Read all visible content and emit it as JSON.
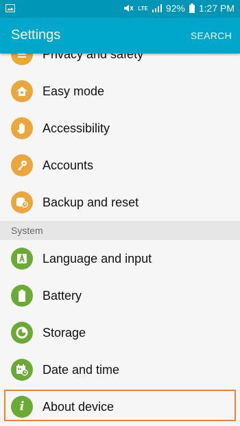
{
  "status_bar": {
    "network": "LTE",
    "battery": "92%",
    "time": "1:27 PM"
  },
  "app_bar": {
    "title": "Settings",
    "search_label": "SEARCH"
  },
  "items_personal": [
    {
      "label": "Privacy and safety",
      "icon": "privacy-icon"
    },
    {
      "label": "Easy mode",
      "icon": "home-icon"
    },
    {
      "label": "Accessibility",
      "icon": "hand-icon"
    },
    {
      "label": "Accounts",
      "icon": "key-icon"
    },
    {
      "label": "Backup and reset",
      "icon": "backup-icon"
    }
  ],
  "section_system": "System",
  "items_system": [
    {
      "label": "Language and input",
      "icon": "language-icon"
    },
    {
      "label": "Battery",
      "icon": "battery-icon"
    },
    {
      "label": "Storage",
      "icon": "storage-icon"
    },
    {
      "label": "Date and time",
      "icon": "calendar-icon"
    },
    {
      "label": "About device",
      "icon": "info-icon"
    }
  ],
  "colors": {
    "app_bar": "#00a7cb",
    "status_bar": "#0096b8",
    "orange_icon": "#eca63a",
    "green_icon": "#6aab34",
    "highlight": "#f2852d"
  }
}
